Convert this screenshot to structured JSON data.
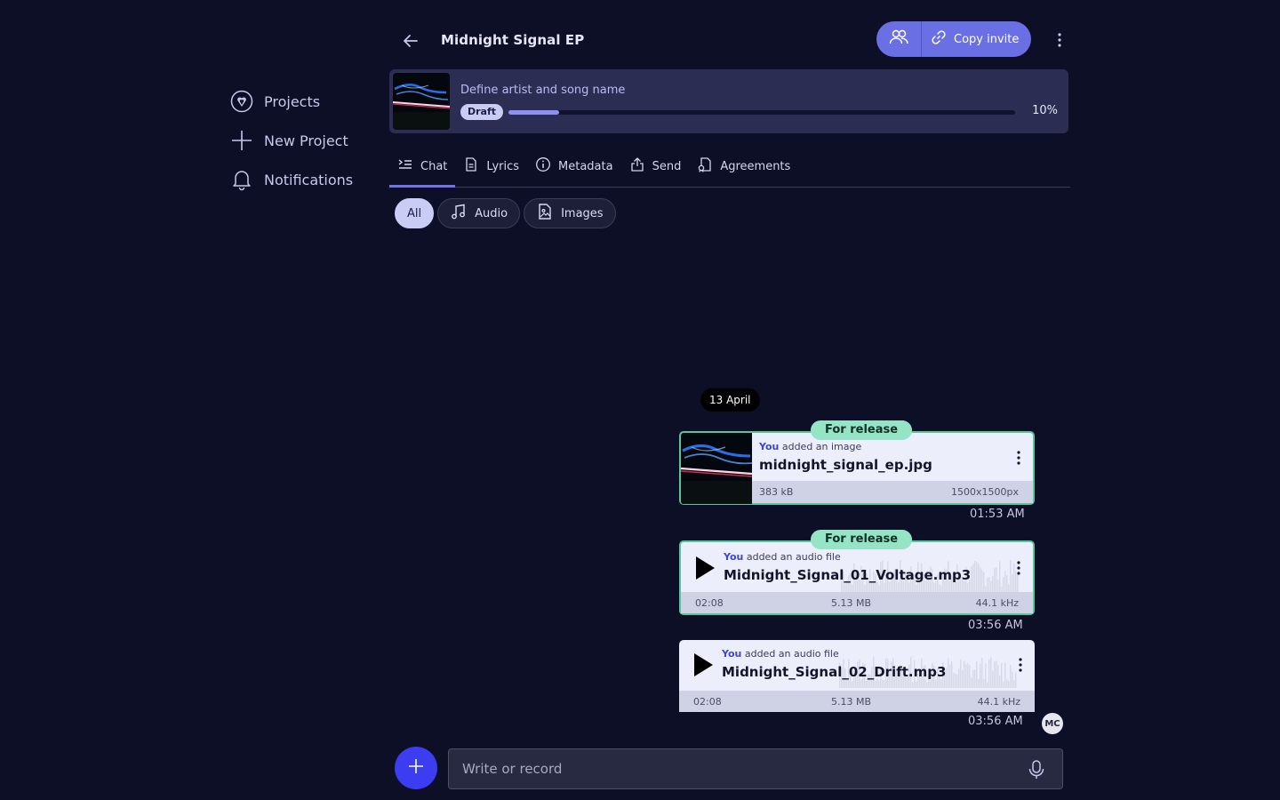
{
  "sidebar": {
    "items": [
      {
        "label": "Projects",
        "icon": "heart-shield-icon"
      },
      {
        "label": "New Project",
        "icon": "plus-icon"
      },
      {
        "label": "Notifications",
        "icon": "bell-icon"
      }
    ]
  },
  "header": {
    "title": "Midnight Signal EP",
    "copy_invite_label": "Copy invite"
  },
  "banner": {
    "task": "Define artist and song name",
    "status": "Draft",
    "progress": 0.1,
    "progress_label": "10%"
  },
  "tabs": [
    {
      "label": "Chat",
      "active": true
    },
    {
      "label": "Lyrics"
    },
    {
      "label": "Metadata"
    },
    {
      "label": "Send"
    },
    {
      "label": "Agreements"
    }
  ],
  "filters": [
    {
      "label": "All",
      "active": true
    },
    {
      "label": "Audio"
    },
    {
      "label": "Images"
    }
  ],
  "chat": {
    "date": "13 April",
    "messages": [
      {
        "tag": "For release",
        "actor": "You",
        "action": " added an image",
        "file": "midnight_signal_ep.jpg",
        "size": "383 kB",
        "dimensions": "1500x1500px",
        "time": "01:53 AM"
      },
      {
        "tag": "For release",
        "actor": "You",
        "action": " added an audio file",
        "file": "Midnight_Signal_01_Voltage.mp3",
        "duration": "02:08",
        "size": "5.13 MB",
        "sample_rate": "44.1 kHz",
        "time": "03:56 AM"
      },
      {
        "actor": "You",
        "action": " added an audio file",
        "file": "Midnight_Signal_02_Drift.mp3",
        "duration": "02:08",
        "size": "5.13 MB",
        "sample_rate": "44.1 kHz",
        "time": "03:56 AM"
      }
    ],
    "avatar_initials": "MC"
  },
  "composer": {
    "placeholder": "Write or record"
  },
  "colors": {
    "background": "#0d0f26",
    "accent": "#6a6fe4",
    "primary_button": "#3c3cf0",
    "release_border": "#55c79c",
    "release_tag": "#94e4c5"
  }
}
